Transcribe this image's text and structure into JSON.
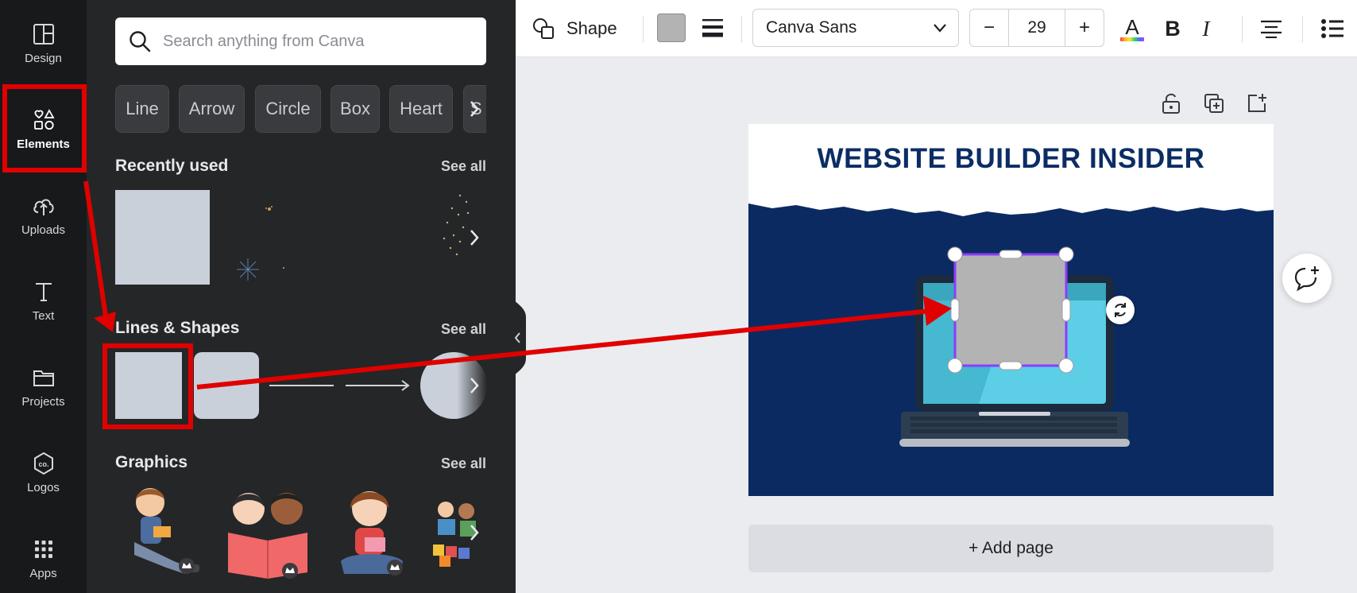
{
  "rail": {
    "items": [
      {
        "label": "Design",
        "icon": "layout-icon"
      },
      {
        "label": "Elements",
        "icon": "shapes-icon",
        "active": true
      },
      {
        "label": "Uploads",
        "icon": "cloud-upload-icon"
      },
      {
        "label": "Text",
        "icon": "text-T-icon"
      },
      {
        "label": "Projects",
        "icon": "folder-icon"
      },
      {
        "label": "Logos",
        "icon": "logo-co-icon"
      },
      {
        "label": "Apps",
        "icon": "apps-grid-icon"
      }
    ]
  },
  "panel": {
    "search_placeholder": "Search anything from Canva",
    "chips": [
      "Line",
      "Arrow",
      "Circle",
      "Box",
      "Heart",
      "S"
    ],
    "recently_used": {
      "title": "Recently used",
      "see_all": "See all"
    },
    "lines_shapes": {
      "title": "Lines & Shapes",
      "see_all": "See all"
    },
    "graphics": {
      "title": "Graphics",
      "see_all": "See all"
    }
  },
  "toolbar": {
    "shape_label": "Shape",
    "fill_color": "#b3b3b3",
    "font_name": "Canva Sans",
    "font_size": "29",
    "minus": "−",
    "plus": "+",
    "bold": "B",
    "italic": "I"
  },
  "canvas": {
    "title": "WEBSITE BUILDER INSIDER",
    "add_page": "+ Add page"
  },
  "colors": {
    "accent_red": "#e00000",
    "page_navy": "#0c2a62",
    "selection_purple": "#8b3dff",
    "shape_gray": "#b3b3b3"
  }
}
